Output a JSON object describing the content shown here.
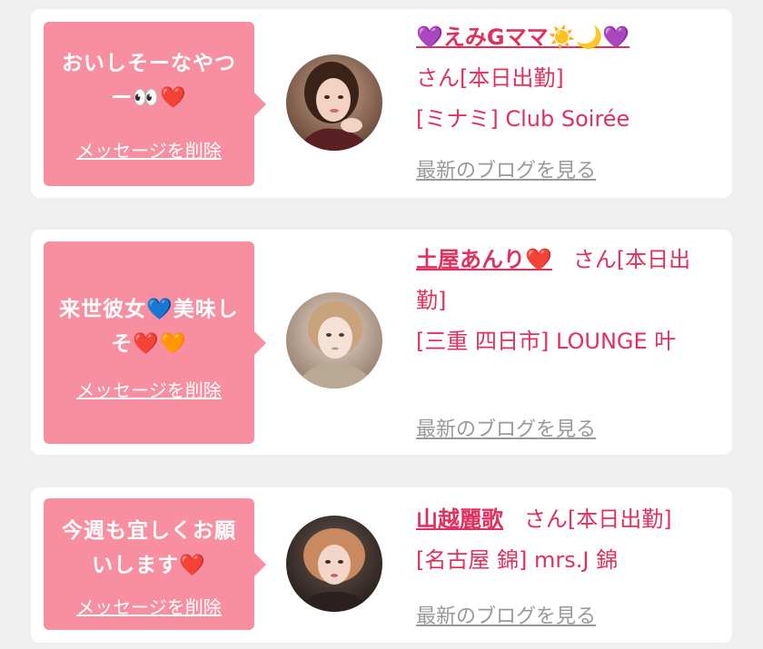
{
  "cards": [
    {
      "message": "おいしそーなやつー👀❤️",
      "delete_label": "メッセージを削除",
      "name": "💜えみGママ☀️🌙💜",
      "honorific": "さん[本日出勤]",
      "shop": "[ミナミ] Club Soirée",
      "blog_label": "最新のブログを見る"
    },
    {
      "message": "来世彼女💙美味しそ❤️🧡",
      "delete_label": "メッセージを削除",
      "name": "土屋あんり❤️",
      "honorific": "さん[本日出勤]",
      "shop": "[三重 四日市] LOUNGE 叶",
      "blog_label": "最新のブログを見る"
    },
    {
      "message": "今週も宜しくお願いします❤️",
      "delete_label": "メッセージを削除",
      "name": "山越麗歌",
      "honorific": "さん[本日出勤]",
      "shop": "[名古屋 錦] mrs.J 錦",
      "blog_label": "最新のブログを見る"
    }
  ],
  "colors": {
    "background": "#efefef",
    "bubble": "#f78fa0",
    "accent_text": "#e2305e",
    "muted_link": "#999999"
  }
}
